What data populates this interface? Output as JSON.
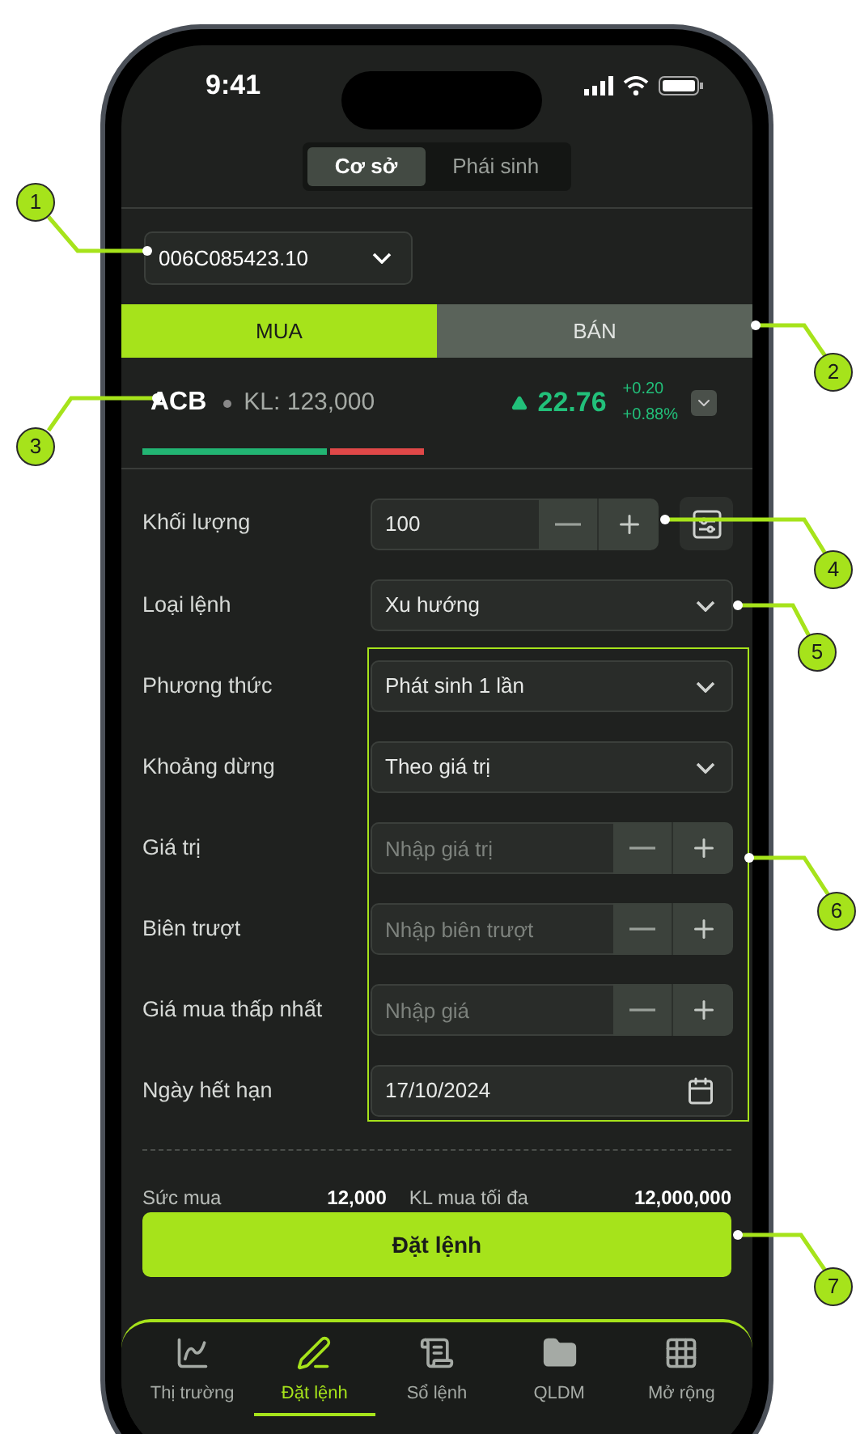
{
  "status_bar": {
    "time": "9:41"
  },
  "market_tabs": [
    {
      "label": "Cơ sở",
      "selected": true
    },
    {
      "label": "Phái sinh",
      "selected": false
    }
  ],
  "account": {
    "value": "006C085423.10"
  },
  "side_tabs": [
    {
      "label": "MUA",
      "selected": true
    },
    {
      "label": "BÁN",
      "selected": false
    }
  ],
  "quote": {
    "symbol": "ACB",
    "volume": "KL: 123,000",
    "price": "22.76",
    "change": "+0.20",
    "change_pct": "+0.88%"
  },
  "form": {
    "fields": [
      {
        "kind": "stepper",
        "label": "Khối lượng",
        "value": "100",
        "settings": true
      },
      {
        "kind": "select",
        "label": "Loại lệnh",
        "value": "Xu hướng"
      },
      {
        "kind": "select",
        "label": "Phương thức",
        "value": "Phát sinh 1 lần"
      },
      {
        "kind": "select",
        "label": "Khoảng dừng",
        "value": "Theo giá trị"
      },
      {
        "kind": "stepper",
        "label": "Giá trị",
        "placeholder": "Nhập giá trị"
      },
      {
        "kind": "stepper",
        "label": "Biên trượt",
        "placeholder": "Nhập biên trượt"
      },
      {
        "kind": "stepper",
        "label": "Giá mua thấp nhất",
        "placeholder": "Nhập giá"
      },
      {
        "kind": "date",
        "label": "Ngày hết hạn",
        "value": "17/10/2024"
      }
    ]
  },
  "summary": [
    {
      "label": "Sức mua",
      "value": "12,000"
    },
    {
      "label": "KL mua tối đa",
      "value": "12,000,000"
    }
  ],
  "submit": {
    "label": "Đặt lệnh"
  },
  "bottom_nav": [
    {
      "label": "Thị trường",
      "selected": false
    },
    {
      "label": "Đặt lệnh",
      "selected": true
    },
    {
      "label": "Sổ lệnh",
      "selected": false
    },
    {
      "label": "QLDM",
      "selected": false
    },
    {
      "label": "Mở rộng",
      "selected": false
    }
  ],
  "callouts": [
    {
      "label": "1"
    },
    {
      "label": "2"
    },
    {
      "label": "3"
    },
    {
      "label": "4"
    },
    {
      "label": "5"
    },
    {
      "label": "6"
    },
    {
      "label": "7"
    }
  ]
}
